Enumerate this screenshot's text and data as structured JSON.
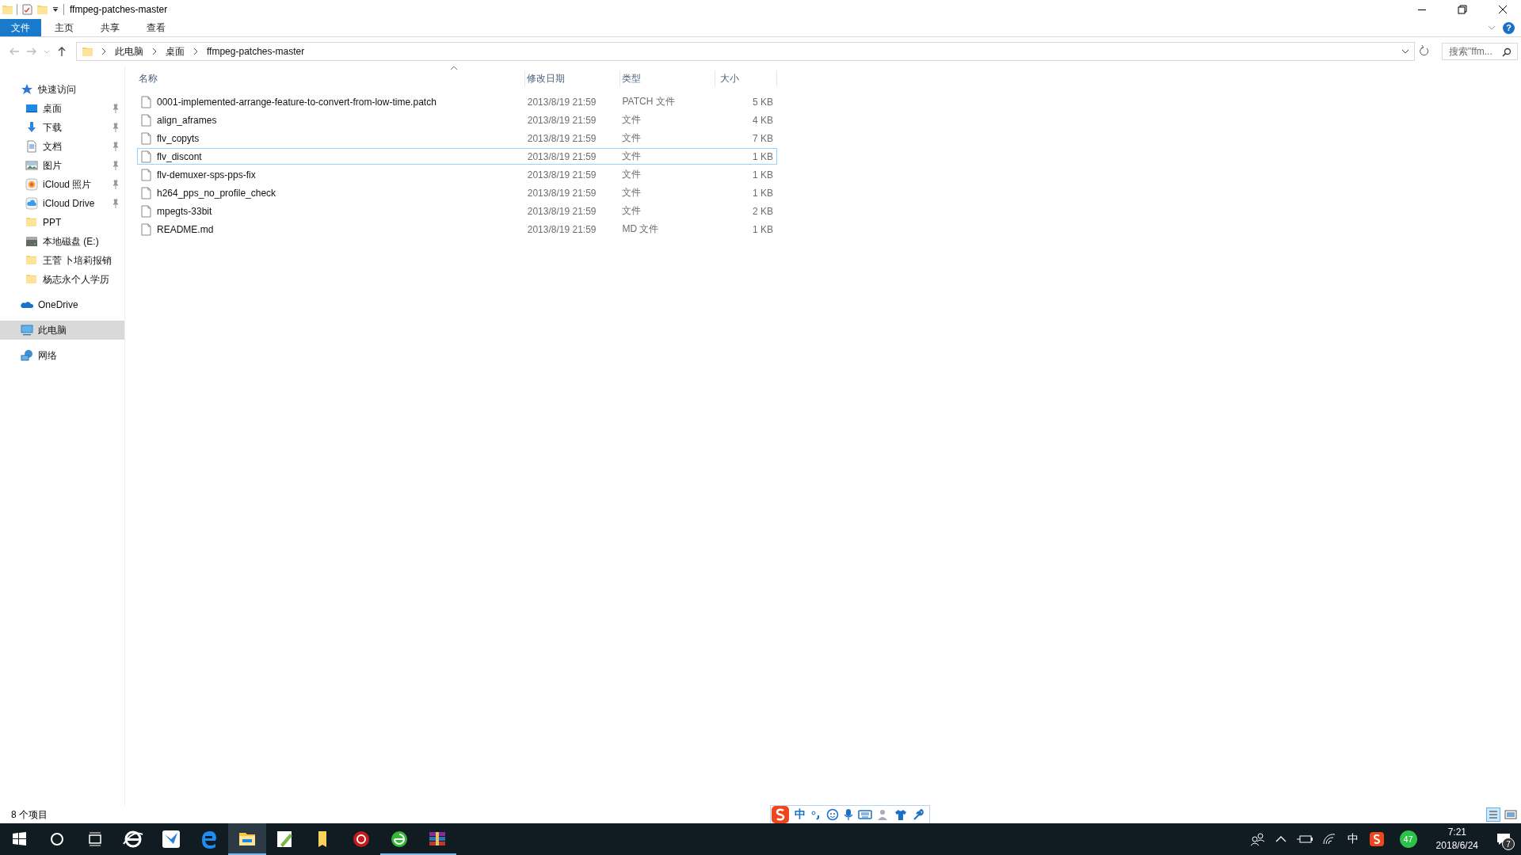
{
  "window": {
    "title": "ffmpeg-patches-master"
  },
  "ribbon_tabs": [
    {
      "label": "文件",
      "kind": "file",
      "selected": false
    },
    {
      "label": "主页",
      "kind": "tab",
      "selected": false
    },
    {
      "label": "共享",
      "kind": "tab",
      "selected": false
    },
    {
      "label": "查看",
      "kind": "tab",
      "selected": false
    }
  ],
  "help_button": "?",
  "address_bar": {
    "crumbs": [
      "此电脑",
      "桌面",
      "ffmpeg-patches-master"
    ]
  },
  "search": {
    "placeholder": "搜索\"ffm..."
  },
  "nav": [
    {
      "label": "快速访问",
      "kind": "star",
      "selected": false,
      "children": [
        {
          "label": "桌面",
          "kind": "desktop",
          "pinned": true,
          "selected": false
        },
        {
          "label": "下载",
          "kind": "download",
          "pinned": true,
          "selected": false
        },
        {
          "label": "文档",
          "kind": "document",
          "pinned": true,
          "selected": false
        },
        {
          "label": "图片",
          "kind": "picture",
          "pinned": true,
          "selected": false
        },
        {
          "label": "iCloud 照片",
          "kind": "photos",
          "pinned": true,
          "selected": false
        },
        {
          "label": "iCloud Drive",
          "kind": "cloud",
          "pinned": true,
          "selected": false
        },
        {
          "label": "PPT",
          "kind": "folder",
          "pinned": false,
          "selected": false
        },
        {
          "label": "本地磁盘 (E:)",
          "kind": "drive",
          "pinned": false,
          "selected": false
        },
        {
          "label": "王菅 卜培莉报销",
          "kind": "folder",
          "pinned": false,
          "selected": false
        },
        {
          "label": "杨志永个人学历",
          "kind": "folder",
          "pinned": false,
          "selected": false
        }
      ]
    },
    {
      "label": "OneDrive",
      "kind": "onedrive",
      "selected": false
    },
    {
      "label": "此电脑",
      "kind": "pc",
      "selected": true
    },
    {
      "label": "网络",
      "kind": "network",
      "selected": false
    }
  ],
  "table": {
    "columns": [
      "名称",
      "修改日期",
      "类型",
      "大小"
    ],
    "rows": [
      {
        "name": "0001-implemented-arrange-feature-to-convert-from-low-time.patch",
        "date": "2013/8/19 21:59",
        "type": "PATCH 文件",
        "size": "5 KB",
        "focused": false
      },
      {
        "name": "align_aframes",
        "date": "2013/8/19 21:59",
        "type": "文件",
        "size": "4 KB",
        "focused": false
      },
      {
        "name": "flv_copyts",
        "date": "2013/8/19 21:59",
        "type": "文件",
        "size": "7 KB",
        "focused": false
      },
      {
        "name": "flv_discont",
        "date": "2013/8/19 21:59",
        "type": "文件",
        "size": "1 KB",
        "focused": true
      },
      {
        "name": "flv-demuxer-sps-pps-fix",
        "date": "2013/8/19 21:59",
        "type": "文件",
        "size": "1 KB",
        "focused": false
      },
      {
        "name": "h264_pps_no_profile_check",
        "date": "2013/8/19 21:59",
        "type": "文件",
        "size": "1 KB",
        "focused": false
      },
      {
        "name": "mpegts-33bit",
        "date": "2013/8/19 21:59",
        "type": "文件",
        "size": "2 KB",
        "focused": false
      },
      {
        "name": "README.md",
        "date": "2013/8/19 21:59",
        "type": "MD 文件",
        "size": "1 KB",
        "focused": false
      }
    ]
  },
  "status_bar": {
    "count": "8 个项目"
  },
  "ime_toolbar": {
    "mode": "中"
  },
  "taskbar": {
    "apps": [
      {
        "kind": "ie",
        "running": false,
        "active": false
      },
      {
        "kind": "bird",
        "running": false,
        "active": false
      },
      {
        "kind": "edge",
        "running": false,
        "active": false
      },
      {
        "kind": "explorer",
        "running": true,
        "active": true
      },
      {
        "kind": "pen",
        "running": false,
        "active": false
      },
      {
        "kind": "note",
        "running": false,
        "active": false
      },
      {
        "kind": "red",
        "running": false,
        "active": false
      },
      {
        "kind": "green",
        "running": true,
        "active": false
      },
      {
        "kind": "books",
        "running": true,
        "active": false
      }
    ],
    "ime": "中",
    "badge": "47",
    "time": "7:21",
    "date": "2018/6/24",
    "notifications": "7"
  }
}
